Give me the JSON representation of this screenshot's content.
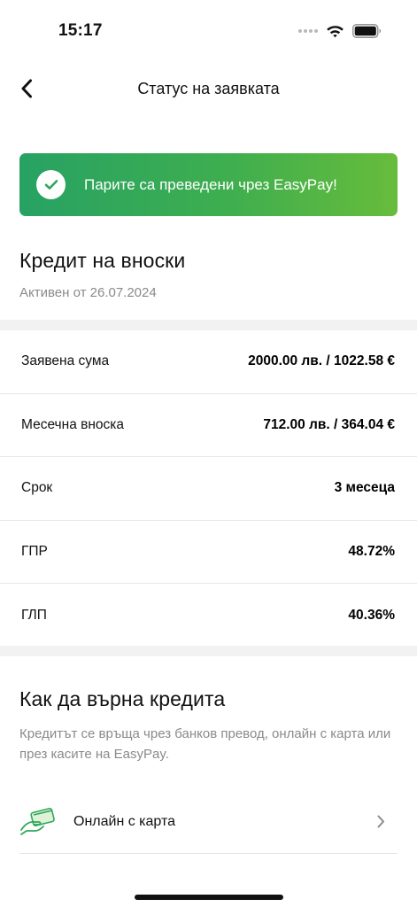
{
  "status_bar": {
    "time": "15:17",
    "icons": [
      "signal-dots",
      "wifi-icon",
      "battery-icon"
    ]
  },
  "nav": {
    "back_icon": "chevron-left-icon",
    "title": "Статус на заявката"
  },
  "banner": {
    "icon": "check-circle-icon",
    "text": "Парите са преведени чрез EasyPay!",
    "gradient_start": "#27a263",
    "gradient_end": "#67bc3b"
  },
  "product": {
    "title": "Кредит на вноски",
    "subtitle": "Активен от 26.07.2024"
  },
  "details": [
    {
      "label": "Заявена сума",
      "value": "2000.00 лв. / 1022.58 €"
    },
    {
      "label": "Месечна вноска",
      "value": "712.00 лв. / 364.04 €"
    },
    {
      "label": "Срок",
      "value": "3 месеца"
    },
    {
      "label": "ГПР",
      "value": "48.72%"
    },
    {
      "label": "ГЛП",
      "value": "40.36%"
    }
  ],
  "repayment": {
    "title": "Как да върна кредита",
    "description": "Кредитът се връща чрез банков превод, онлайн с карта или през касите на EasyPay.",
    "options": [
      {
        "icon": "card-payment-icon",
        "label": "Онлайн с карта"
      }
    ]
  },
  "colors": {
    "accent_green": "#3eae4f",
    "muted_text": "#8a8a8a",
    "separator": "#f2f2f2"
  }
}
